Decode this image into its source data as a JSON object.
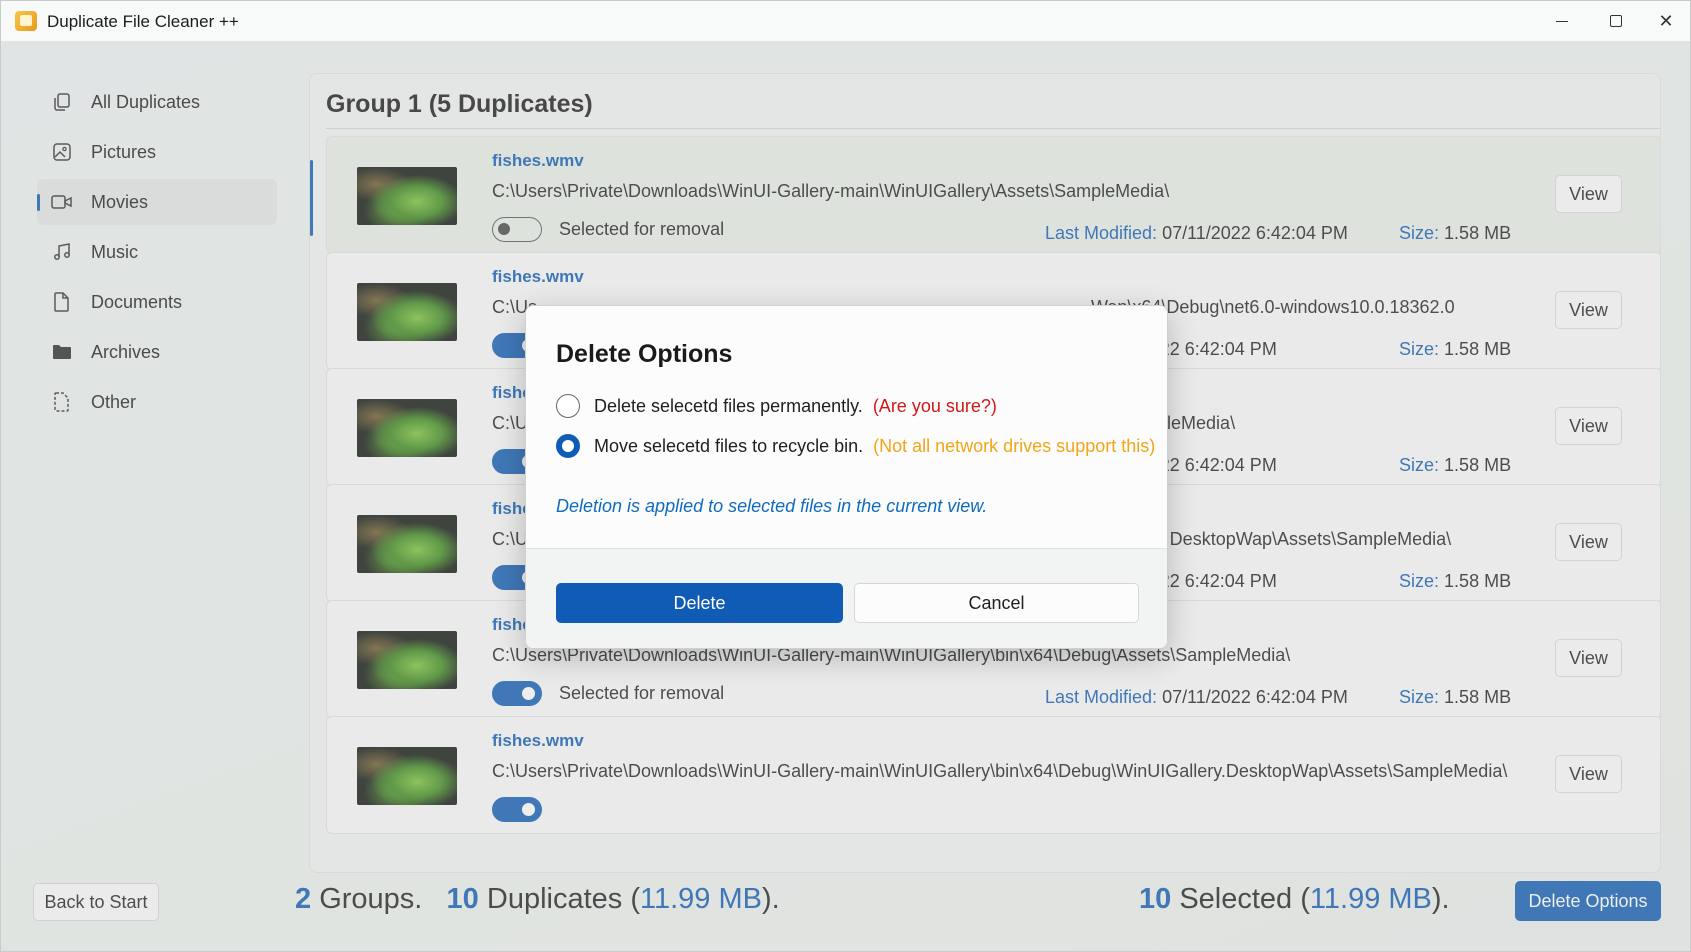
{
  "window": {
    "title": "Duplicate File Cleaner ++"
  },
  "sidebar": {
    "items": [
      {
        "label": "All Duplicates",
        "icon": "copy-icon",
        "active": false
      },
      {
        "label": "Pictures",
        "icon": "picture-icon",
        "active": false
      },
      {
        "label": "Movies",
        "icon": "video-icon",
        "active": true
      },
      {
        "label": "Music",
        "icon": "music-note-icon",
        "active": false
      },
      {
        "label": "Documents",
        "icon": "document-icon",
        "active": false
      },
      {
        "label": "Archives",
        "icon": "folder-icon",
        "active": false
      },
      {
        "label": "Other",
        "icon": "file-other-icon",
        "active": false
      }
    ]
  },
  "group": {
    "title": "Group 1 (5 Duplicates)",
    "files": [
      {
        "name": "fishes.wmv",
        "path": "C:\\Users\\Private\\Downloads\\WinUI-Gallery-main\\WinUIGallery\\Assets\\SampleMedia\\",
        "toggle_label": "Selected for removal",
        "selected": false,
        "modified_key": "Last Modified:",
        "modified": "07/11/2022 6:42:04 PM",
        "size_key": "Size:",
        "size": "1.58 MB",
        "view_label": "View"
      },
      {
        "name": "fishes.wmv",
        "path": "C:\\Us",
        "path_tail": "Wap\\x64\\Debug\\net6.0-windows10.0.18362.0",
        "toggle_label": "",
        "selected": true,
        "modified_key": "",
        "modified": "07/11/2022 6:42:04 PM",
        "size_key": "Size:",
        "size": "1.58 MB",
        "view_label": "View"
      },
      {
        "name": "fishes",
        "path": "C:\\Us",
        "path_tail": "ets\\SampleMedia\\",
        "toggle_label": "",
        "selected": true,
        "modified_key": "",
        "modified": "07/11/2022 6:42:04 PM",
        "size_key": "Size:",
        "size": "1.58 MB",
        "view_label": "View"
      },
      {
        "name": "fishes",
        "path": "C:\\Us",
        "path_tail": "UIGallery.DesktopWap\\Assets\\SampleMedia\\",
        "toggle_label": "",
        "selected": true,
        "modified_key": "",
        "modified": "07/11/2022 6:42:04 PM",
        "size_key": "Size:",
        "size": "1.58 MB",
        "view_label": "View"
      },
      {
        "name": "fishes.wmv",
        "path": "C:\\Users\\Private\\Downloads\\WinUI-Gallery-main\\WinUIGallery\\bin\\x64\\Debug\\Assets\\SampleMedia\\",
        "toggle_label": "Selected for removal",
        "selected": true,
        "modified_key": "Last Modified:",
        "modified": "07/11/2022 6:42:04 PM",
        "size_key": "Size:",
        "size": "1.58 MB",
        "view_label": "View"
      },
      {
        "name": "fishes.wmv",
        "path": "C:\\Users\\Private\\Downloads\\WinUI-Gallery-main\\WinUIGallery\\bin\\x64\\Debug\\WinUIGallery.DesktopWap\\Assets\\SampleMedia\\",
        "toggle_label": "",
        "selected": true,
        "modified_key": "",
        "modified": "",
        "size_key": "",
        "size": "",
        "view_label": "View"
      }
    ]
  },
  "footer": {
    "back_label": "Back to Start",
    "groups_count": "2",
    "groups_label": "Groups.",
    "duplicates_count": "10",
    "duplicates_label": "Duplicates (",
    "duplicates_size": "11.99 MB",
    "duplicates_close": ").",
    "selected_count": "10",
    "selected_label": "Selected (",
    "selected_size": "11.99 MB",
    "selected_close": ").",
    "delete_options_label": "Delete Options"
  },
  "dialog": {
    "title": "Delete Options",
    "option_permanent": "Delete selecetd files permanently.",
    "option_permanent_warning": "(Are you sure?)",
    "option_recycle": "Move selecetd files to recycle bin.",
    "option_recycle_warning": "(Not all network drives support this)",
    "selected_option": "recycle",
    "note": "Deletion is applied to selected files in the current view.",
    "delete_label": "Delete",
    "cancel_label": "Cancel"
  },
  "colors": {
    "accent": "#0f5bb5",
    "warning_red": "#d01818",
    "warning_orange": "#f2a516"
  }
}
